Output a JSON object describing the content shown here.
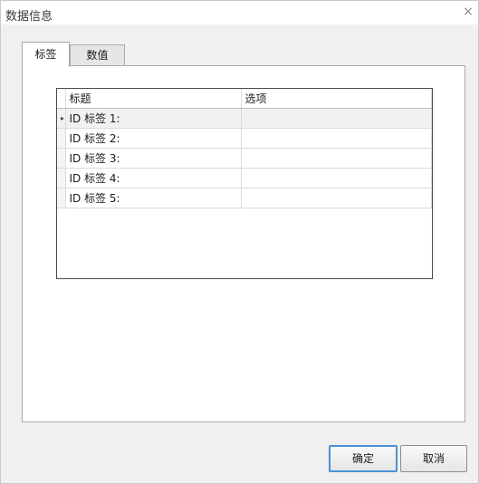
{
  "dialog": {
    "title": "数据信息",
    "close_glyph": "×"
  },
  "tabs": [
    {
      "label": "标签",
      "active": true
    },
    {
      "label": "数值",
      "active": false
    }
  ],
  "grid": {
    "columns": [
      "标题",
      "选项"
    ],
    "rows": [
      {
        "title": "ID 标签 1:",
        "option": ""
      },
      {
        "title": "ID 标签 2:",
        "option": ""
      },
      {
        "title": "ID 标签 3:",
        "option": ""
      },
      {
        "title": "ID 标签 4:",
        "option": ""
      },
      {
        "title": "ID 标签 5:",
        "option": ""
      }
    ],
    "current_row_indicator": "▸"
  },
  "buttons": {
    "ok": "确定",
    "cancel": "取消"
  }
}
